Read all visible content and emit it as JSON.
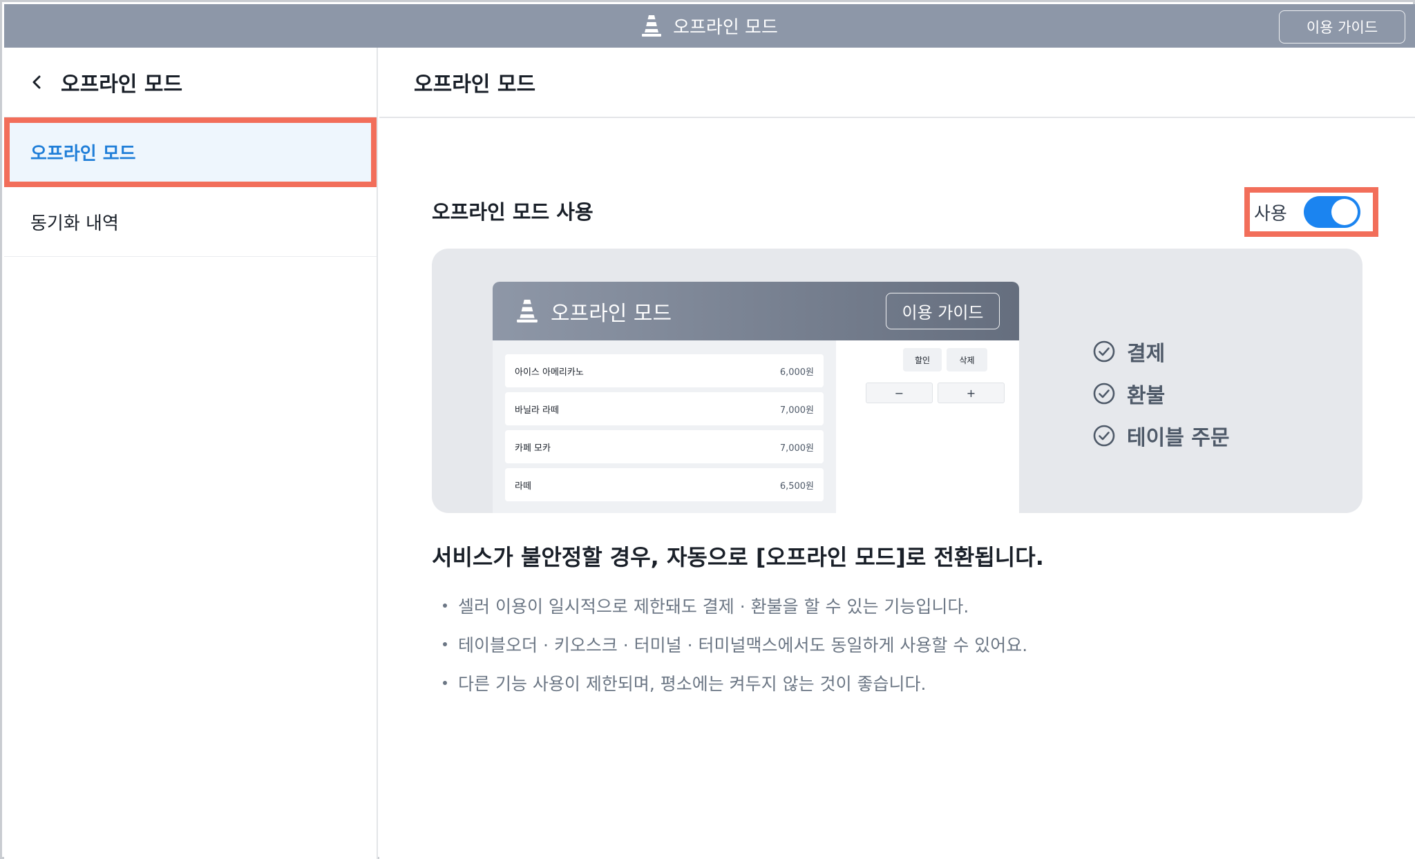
{
  "topbar": {
    "title": "오프라인 모드",
    "guide_button": "이용 가이드"
  },
  "sidebar": {
    "title": "오프라인 모드",
    "items": [
      {
        "label": "오프라인 모드",
        "active": true
      },
      {
        "label": "동기화 내역",
        "active": false
      }
    ]
  },
  "main": {
    "title": "오프라인 모드",
    "setting": {
      "label": "오프라인 모드 사용",
      "toggle_label": "사용",
      "toggle_on": true
    },
    "preview": {
      "app_title": "오프라인 모드",
      "guide_button": "이용 가이드",
      "items": [
        {
          "name": "아이스 아메리카노",
          "price": "6,000원"
        },
        {
          "name": "바닐라 라떼",
          "price": "7,000원"
        },
        {
          "name": "카페 모카",
          "price": "7,000원"
        },
        {
          "name": "라떼",
          "price": "6,500원"
        }
      ],
      "discount_button": "할인",
      "delete_button": "삭제",
      "minus": "−",
      "plus": "+",
      "features": [
        "결제",
        "환불",
        "테이블 주문"
      ]
    },
    "description": {
      "title": "서비스가 불안정할 경우, 자동으로 [오프라인 모드]로 전환됩니다.",
      "bullets": [
        "셀러 이용이 일시적으로 제한돼도 결제 · 환불을 할 수 있는 기능입니다.",
        "테이블오더 · 키오스크 · 터미널 · 터미널맥스에서도 동일하게 사용할 수 있어요.",
        "다른 기능 사용이 제한되며, 평소에는 켜두지 않는 것이 좋습니다."
      ]
    }
  },
  "colors": {
    "topbar": "#8d97a8",
    "accent": "#1b84f0",
    "highlight": "#f26e5a",
    "active_item_bg": "#eef6fd",
    "active_item_text": "#1f7ed8"
  }
}
